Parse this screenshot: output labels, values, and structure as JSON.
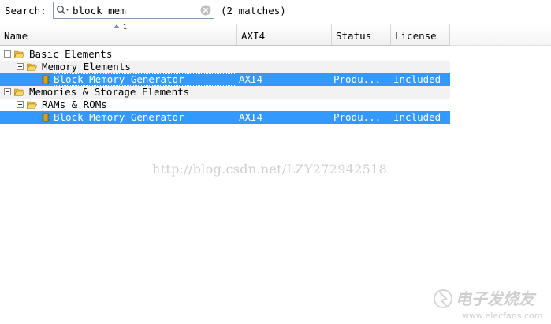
{
  "search": {
    "label": "Search:",
    "value": "block mem",
    "match_count": "(2 matches)"
  },
  "columns": {
    "name": "Name",
    "interface": "AXI4",
    "status": "Status",
    "license": "License",
    "sort_order": "1"
  },
  "tree": {
    "basic_elements": "Basic Elements",
    "memory_elements": "Memory Elements",
    "block_mem_1": {
      "name": "Block Memory Generator",
      "axi": "AXI4",
      "status": "Produ...",
      "license": "Included"
    },
    "memories_storage": "Memories & Storage Elements",
    "rams_roms": "RAMs & ROMs",
    "block_mem_2": {
      "name": "Block Memory Generator",
      "axi": "AXI4",
      "status": "Produ...",
      "license": "Included"
    }
  },
  "watermark": {
    "url_text": "http://blog.csdn.net/LZY272942518",
    "logo_text": "电子发烧友",
    "logo_domain": "www.elecfans.com"
  },
  "colors": {
    "selection": "#3399ff",
    "folder": "#f0c040"
  }
}
